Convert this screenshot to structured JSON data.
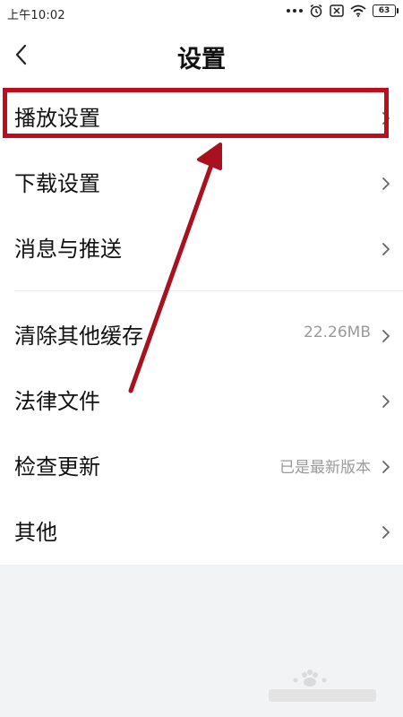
{
  "status_bar": {
    "time": "上午10:02",
    "battery": "63",
    "icons": [
      "more-dots-icon",
      "alarm-icon",
      "silent-icon",
      "wifi-icon",
      "battery-icon"
    ]
  },
  "header": {
    "title": "设置",
    "back_icon": "chevron-left-icon"
  },
  "settings": {
    "items": [
      {
        "label": "播放设置",
        "value": "",
        "highlighted": true
      },
      {
        "label": "下载设置",
        "value": ""
      },
      {
        "label": "消息与推送",
        "value": ""
      },
      {
        "label": "清除其他缓存",
        "value": "22.26MB"
      },
      {
        "label": "法律文件",
        "value": ""
      },
      {
        "label": "检查更新",
        "value": "已是最新版本"
      },
      {
        "label": "其他",
        "value": ""
      }
    ]
  },
  "colors": {
    "highlight": "#c00d1e",
    "arrow": "#a8111e",
    "value_text": "#9a9a9a",
    "background": "#f2f3f5"
  }
}
